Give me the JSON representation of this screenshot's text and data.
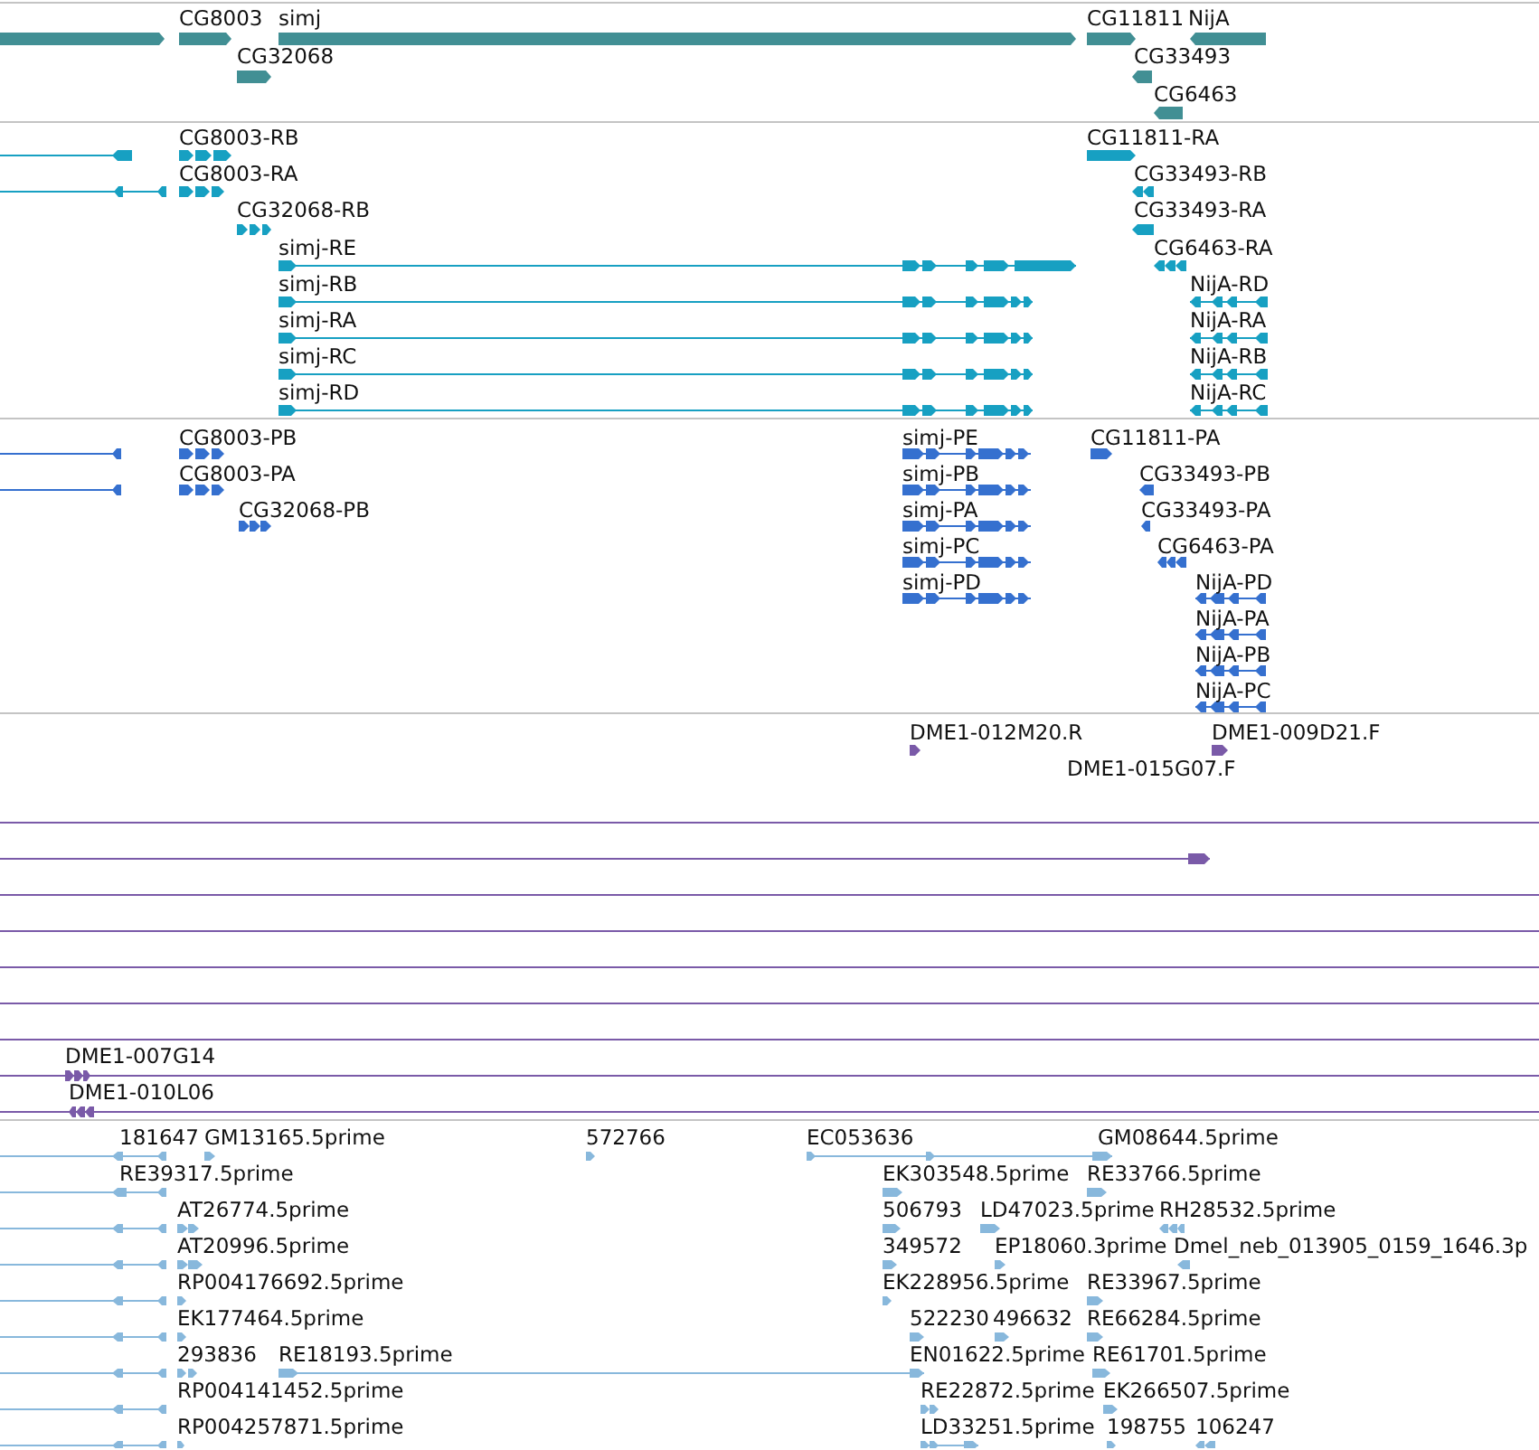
{
  "tracks": [
    {
      "kind": "genes",
      "features": [
        {
          "forward": true
        },
        {
          "label": "CG8003",
          "forward": true
        },
        {
          "label": "simj",
          "forward": true
        },
        {
          "label": "CG32068",
          "forward": true
        },
        {
          "label": "CG11811",
          "forward": true
        },
        {
          "label": "NijA",
          "forward": false
        },
        {
          "label": "CG33493",
          "forward": false
        },
        {
          "label": "CG6463",
          "forward": false
        }
      ]
    },
    {
      "kind": "transcripts",
      "features": [
        {
          "forward": false
        },
        {
          "forward": false
        },
        {
          "label": "CG8003-RB",
          "forward": true
        },
        {
          "label": "CG8003-RA",
          "forward": true
        },
        {
          "label": "CG32068-RB",
          "forward": true
        },
        {
          "label": "simj-RE",
          "forward": true
        },
        {
          "label": "simj-RB",
          "forward": true
        },
        {
          "label": "simj-RA",
          "forward": true
        },
        {
          "label": "simj-RC",
          "forward": true
        },
        {
          "label": "simj-RD",
          "forward": true
        },
        {
          "label": "CG11811-RA",
          "forward": true
        },
        {
          "label": "CG33493-RB",
          "forward": false
        },
        {
          "label": "CG33493-RA",
          "forward": false
        },
        {
          "label": "CG6463-RA",
          "forward": false
        },
        {
          "label": "NijA-RD",
          "forward": false
        },
        {
          "label": "NijA-RA",
          "forward": false
        },
        {
          "label": "NijA-RB",
          "forward": false
        },
        {
          "label": "NijA-RC",
          "forward": false
        }
      ]
    },
    {
      "kind": "proteins",
      "features": [
        {
          "forward": false
        },
        {
          "forward": false
        },
        {
          "label": "CG8003-PB",
          "forward": true
        },
        {
          "label": "CG8003-PA",
          "forward": true
        },
        {
          "label": "CG32068-PB",
          "forward": true
        },
        {
          "label": "simj-PE",
          "forward": true
        },
        {
          "label": "simj-PB",
          "forward": true
        },
        {
          "label": "simj-PA",
          "forward": true
        },
        {
          "label": "simj-PC",
          "forward": true
        },
        {
          "label": "simj-PD",
          "forward": true
        },
        {
          "label": "CG11811-PA",
          "forward": true
        },
        {
          "label": "CG33493-PB",
          "forward": false
        },
        {
          "label": "CG33493-PA",
          "forward": false
        },
        {
          "label": "CG6463-PA",
          "forward": false
        },
        {
          "label": "NijA-PD",
          "forward": false
        },
        {
          "label": "NijA-PA",
          "forward": false
        },
        {
          "label": "NijA-PB",
          "forward": false
        },
        {
          "label": "NijA-PC",
          "forward": false
        }
      ]
    },
    {
      "kind": "clones",
      "features": [
        {
          "kind": "read",
          "label": "DME1-012M20.R",
          "forward": true
        },
        {
          "kind": "read",
          "label": "DME1-009D21.F",
          "forward": true
        },
        {
          "kind": "read",
          "label": "DME1-015G07.F"
        },
        {
          "kind": "line"
        },
        {
          "kind": "read",
          "forward": true
        },
        {
          "kind": "line"
        },
        {
          "kind": "line"
        },
        {
          "kind": "line"
        },
        {
          "kind": "line"
        },
        {
          "kind": "line"
        },
        {
          "kind": "read",
          "label": "DME1-007G14",
          "forward": true
        },
        {
          "kind": "read",
          "label": "DME1-010L06",
          "forward": false
        }
      ]
    },
    {
      "kind": "ests",
      "features": [
        {
          "label": "181647",
          "forward": false
        },
        {
          "label": "GM13165.5prime",
          "forward": true
        },
        {
          "label": "572766",
          "forward": true
        },
        {
          "label": "EC053636",
          "forward": true
        },
        {
          "label": "GM08644.5prime"
        },
        {
          "label": "RE39317.5prime",
          "forward": false
        },
        {
          "label": "EK303548.5prime",
          "forward": true
        },
        {
          "label": "RE33766.5prime",
          "forward": true
        },
        {
          "label": "AT26774.5prime",
          "forward": true
        },
        {
          "label": "506793",
          "forward": true
        },
        {
          "label": "LD47023.5prime",
          "forward": true
        },
        {
          "label": "RH28532.5prime",
          "forward": false
        },
        {
          "label": "AT20996.5prime",
          "forward": true
        },
        {
          "label": "349572",
          "forward": true
        },
        {
          "label": "EP18060.3prime",
          "forward": true
        },
        {
          "label": "Dmel_neb_013905_0159_1646.3p",
          "forward": false
        },
        {
          "label": "RP004176692.5prime",
          "forward": true
        },
        {
          "label": "EK228956.5prime",
          "forward": true
        },
        {
          "label": "RE33967.5prime",
          "forward": true
        },
        {
          "label": "EK177464.5prime",
          "forward": true
        },
        {
          "label": "522230",
          "forward": true
        },
        {
          "label": "496632",
          "forward": true
        },
        {
          "label": "RE66284.5prime",
          "forward": true
        },
        {
          "label": "293836",
          "forward": true
        },
        {
          "label": "RE18193.5prime",
          "forward": true
        },
        {
          "label": "EN01622.5prime"
        },
        {
          "label": "RE61701.5prime",
          "forward": true
        },
        {
          "label": "RP004141452.5prime"
        },
        {
          "label": "RE22872.5prime",
          "forward": true
        },
        {
          "label": "EK266507.5prime",
          "forward": true
        },
        {
          "label": "RP004257871.5prime",
          "forward": true
        },
        {
          "label": "LD33251.5prime",
          "forward": true
        },
        {
          "label": "198755",
          "forward": true
        },
        {
          "label": "106247",
          "forward": false
        },
        {
          "forward": false
        },
        {
          "forward": false
        },
        {
          "forward": false
        },
        {
          "forward": false
        },
        {
          "forward": false
        },
        {
          "forward": false
        },
        {
          "forward": false
        }
      ]
    }
  ]
}
